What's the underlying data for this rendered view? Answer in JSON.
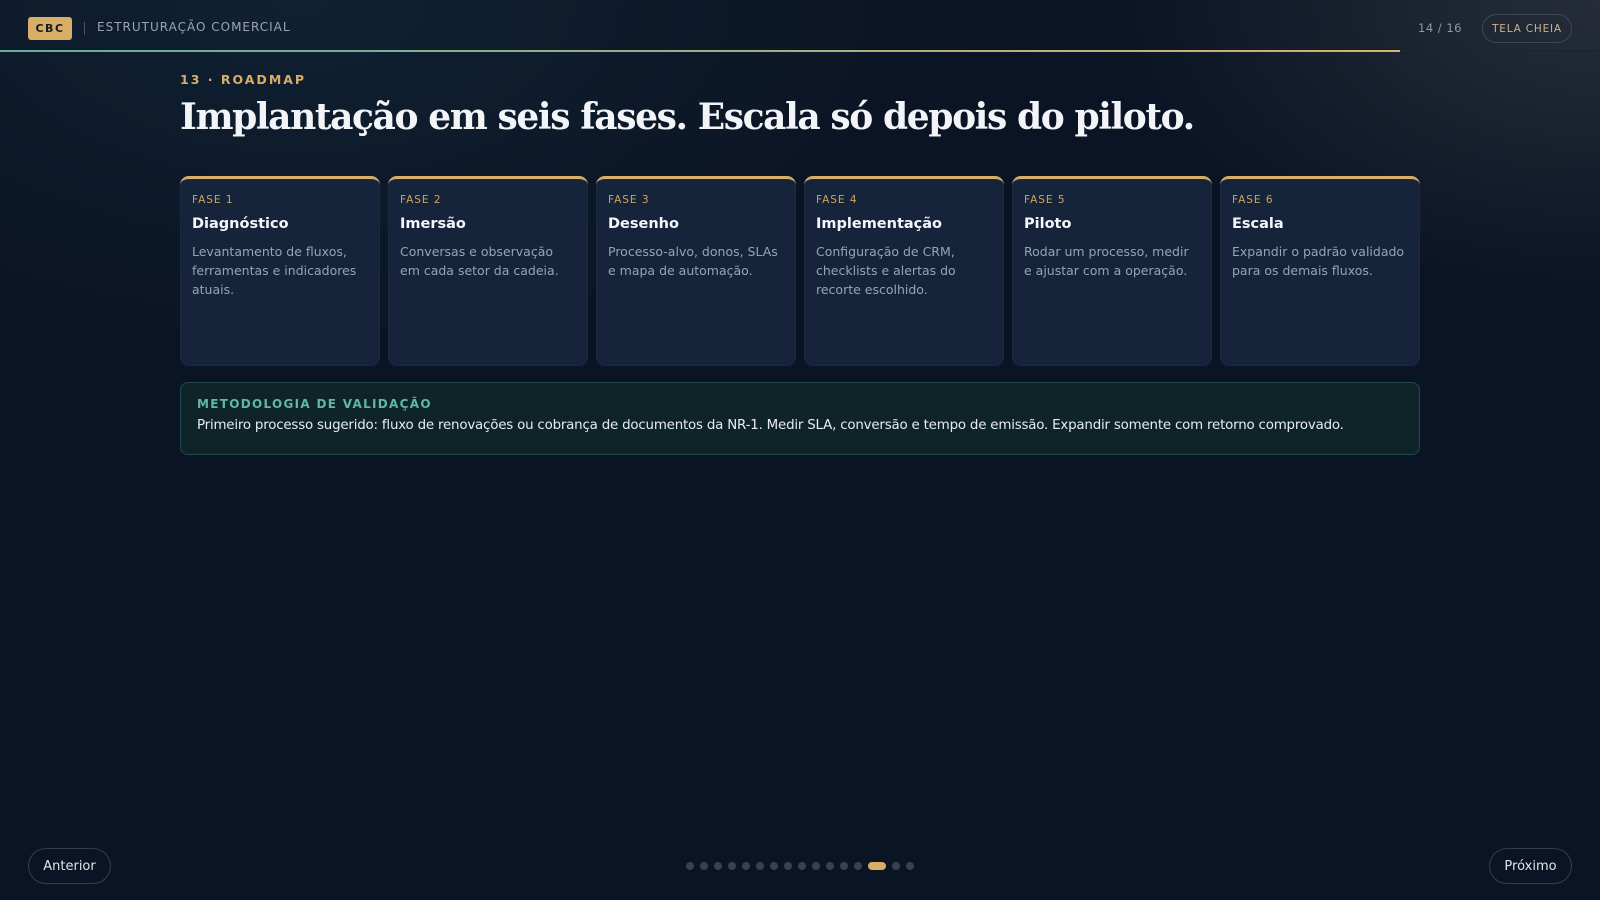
{
  "header": {
    "logo": "CBC",
    "section": "ESTRUTURAÇÃO COMERCIAL",
    "counter": "14 / 16",
    "fullscreen_label": "TELA CHEIA",
    "progress": 0.875
  },
  "slide": {
    "eyebrow": "13 · ROADMAP",
    "title": "Implantação em seis fases. Escala só depois do piloto.",
    "phases": [
      {
        "label": "FASE 1",
        "title": "Diagnóstico",
        "desc": "Levantamento de fluxos, ferramentas e indicadores atuais."
      },
      {
        "label": "FASE 2",
        "title": "Imersão",
        "desc": "Conversas e observação em cada setor da cadeia."
      },
      {
        "label": "FASE 3",
        "title": "Desenho",
        "desc": "Processo-alvo, donos, SLAs e mapa de automação."
      },
      {
        "label": "FASE 4",
        "title": "Implementação",
        "desc": "Configuração de CRM, checklists e alertas do recorte escolhido."
      },
      {
        "label": "FASE 5",
        "title": "Piloto",
        "desc": "Rodar um processo, medir e ajustar com a operação."
      },
      {
        "label": "FASE 6",
        "title": "Escala",
        "desc": "Expandir o padrão validado para os demais fluxos."
      }
    ],
    "methodology": {
      "label": "METODOLOGIA DE VALIDAÇÃO",
      "text": "Primeiro processo sugerido: fluxo de renovações ou cobrança de documentos da NR-1. Medir SLA, conversão e tempo de emissão. Expandir somente com retorno comprovado."
    }
  },
  "nav": {
    "prev_label": "Anterior",
    "next_label": "Próximo",
    "total_slides": 16,
    "current_index": 14
  },
  "colors": {
    "accent": "#d8ad66",
    "teal": "#61b7a6",
    "background": "#0b1424",
    "card": "#15243b"
  }
}
